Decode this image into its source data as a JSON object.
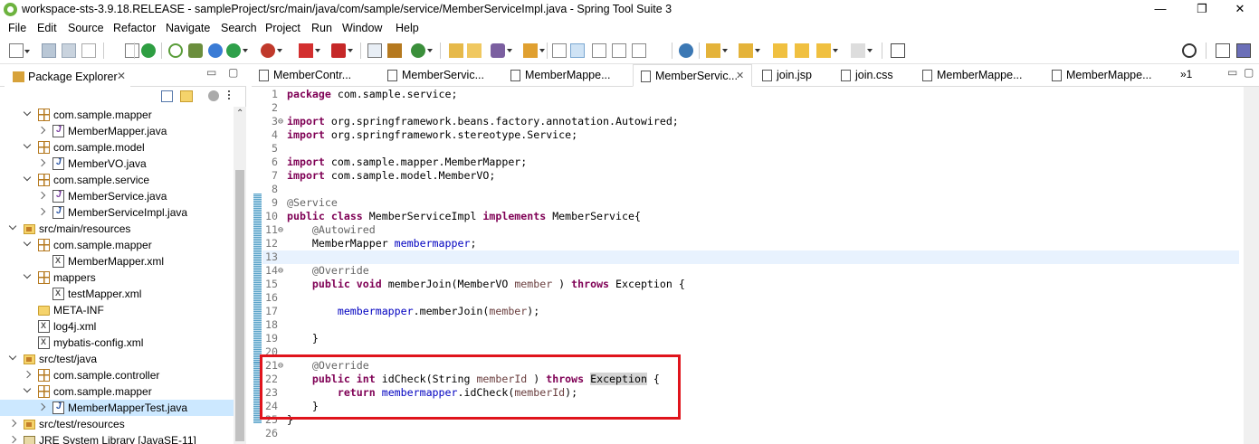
{
  "window": {
    "title": "workspace-sts-3.9.18.RELEASE - sampleProject/src/main/java/com/sample/service/MemberServiceImpl.java - Spring Tool Suite 3",
    "minimize": "—",
    "maximize": "❐",
    "close": "✕"
  },
  "menu": [
    "File",
    "Edit",
    "Source",
    "Refactor",
    "Navigate",
    "Search",
    "Project",
    "Run",
    "Window",
    "Help"
  ],
  "package_explorer": {
    "title": "Package Explorer",
    "close": "✕",
    "minimize": "▭",
    "maximize": "▢",
    "tree": [
      {
        "label": "com.sample.mapper",
        "icon": "package-icon",
        "twisty": "open",
        "level": 3
      },
      {
        "label": "MemberMapper.java",
        "icon": "interface-file-icon",
        "twisty": "closed",
        "level": 4
      },
      {
        "label": "com.sample.model",
        "icon": "package-icon",
        "twisty": "open",
        "level": 3
      },
      {
        "label": "MemberVO.java",
        "icon": "java-file-icon",
        "twisty": "closed",
        "level": 4
      },
      {
        "label": "com.sample.service",
        "icon": "package-icon",
        "twisty": "open",
        "level": 3
      },
      {
        "label": "MemberService.java",
        "icon": "interface-file-icon",
        "twisty": "closed",
        "level": 4
      },
      {
        "label": "MemberServiceImpl.java",
        "icon": "java-file-icon",
        "twisty": "closed",
        "level": 4
      },
      {
        "label": "src/main/resources",
        "icon": "source-folder-icon",
        "twisty": "open",
        "level": 2
      },
      {
        "label": "com.sample.mapper",
        "icon": "package-icon",
        "twisty": "open",
        "level": 3
      },
      {
        "label": "MemberMapper.xml",
        "icon": "xml-file-icon",
        "twisty": "none",
        "level": 4
      },
      {
        "label": "mappers",
        "icon": "package-icon",
        "twisty": "open",
        "level": 3
      },
      {
        "label": "testMapper.xml",
        "icon": "xml-file-icon",
        "twisty": "none",
        "level": 4
      },
      {
        "label": "META-INF",
        "icon": "folder-icon",
        "twisty": "none",
        "level": 3
      },
      {
        "label": "log4j.xml",
        "icon": "xml-file-icon",
        "twisty": "none",
        "level": 3
      },
      {
        "label": "mybatis-config.xml",
        "icon": "xml-file-icon",
        "twisty": "none",
        "level": 3
      },
      {
        "label": "src/test/java",
        "icon": "source-folder-icon",
        "twisty": "open",
        "level": 2
      },
      {
        "label": "com.sample.controller",
        "icon": "package-icon",
        "twisty": "closed",
        "level": 3
      },
      {
        "label": "com.sample.mapper",
        "icon": "package-icon",
        "twisty": "open",
        "level": 3
      },
      {
        "label": "MemberMapperTest.java",
        "icon": "java-file-icon",
        "twisty": "closed",
        "level": 4,
        "selected": true
      },
      {
        "label": "src/test/resources",
        "icon": "source-folder-icon",
        "twisty": "closed",
        "level": 2
      },
      {
        "label": "JRE System Library [JavaSE-11]",
        "icon": "library-icon",
        "twisty": "closed",
        "level": 2
      }
    ]
  },
  "editor_tabs": [
    {
      "label": "MemberContr...",
      "icon": "java-file-icon"
    },
    {
      "label": "MemberServic...",
      "icon": "interface-file-icon"
    },
    {
      "label": "MemberMappe...",
      "icon": "interface-file-icon"
    },
    {
      "label": "MemberServic...",
      "icon": "java-file-icon",
      "active": true,
      "close": "✕"
    },
    {
      "label": "join.jsp",
      "icon": "jsp-file-icon"
    },
    {
      "label": "join.css",
      "icon": "css-file-icon"
    },
    {
      "label": "MemberMappe...",
      "icon": "xml-file-icon"
    },
    {
      "label": "MemberMappe...",
      "icon": "java-file-icon"
    }
  ],
  "overflow_tabs": "»1",
  "code_lines": [
    {
      "n": "1",
      "parts": [
        [
          "k",
          "package"
        ],
        [
          "",
          "com.sample.service;"
        ]
      ]
    },
    {
      "n": "2",
      "parts": []
    },
    {
      "n": "3",
      "fold": "⊖",
      "parts": [
        [
          "k",
          "import"
        ],
        [
          "",
          "org.springframework.beans.factory.annotation.Autowired;"
        ]
      ]
    },
    {
      "n": "4",
      "parts": [
        [
          "k",
          "import"
        ],
        [
          "",
          "org.springframework.stereotype.Service;"
        ]
      ]
    },
    {
      "n": "5",
      "parts": []
    },
    {
      "n": "6",
      "parts": [
        [
          "k",
          "import"
        ],
        [
          "",
          "com.sample.mapper.MemberMapper;"
        ]
      ]
    },
    {
      "n": "7",
      "parts": [
        [
          "k",
          "import"
        ],
        [
          "",
          "com.sample.model.MemberVO;"
        ]
      ]
    },
    {
      "n": "8",
      "parts": []
    },
    {
      "n": "9",
      "parts": [
        [
          "an",
          "@Service"
        ]
      ]
    },
    {
      "n": "10",
      "parts": [
        [
          "k",
          "public"
        ],
        [
          "",
          " "
        ],
        [
          "k",
          "class"
        ],
        [
          "",
          " MemberServiceImpl "
        ],
        [
          "k",
          "implements"
        ],
        [
          "",
          " MemberService{"
        ]
      ]
    },
    {
      "n": "11",
      "fold": "⊖",
      "parts": [
        [
          "",
          "    "
        ],
        [
          "an",
          "@Autowired"
        ]
      ]
    },
    {
      "n": "12",
      "parts": [
        [
          "",
          "    MemberMapper "
        ],
        [
          "fld",
          "membermapper"
        ],
        [
          "",
          ";"
        ]
      ]
    },
    {
      "n": "13",
      "cur": true,
      "parts": []
    },
    {
      "n": "14",
      "fold": "⊖",
      "parts": [
        [
          "",
          "    "
        ],
        [
          "an",
          "@Override"
        ]
      ]
    },
    {
      "n": "15",
      "parts": [
        [
          "",
          "    "
        ],
        [
          "k",
          "public"
        ],
        [
          "",
          " "
        ],
        [
          "k",
          "void"
        ],
        [
          "",
          " memberJoin(MemberVO "
        ],
        [
          "prm",
          "member"
        ],
        [
          "",
          " ) "
        ],
        [
          "k",
          "throws"
        ],
        [
          "",
          " Exception {"
        ]
      ]
    },
    {
      "n": "16",
      "parts": []
    },
    {
      "n": "17",
      "parts": [
        [
          "",
          "        "
        ],
        [
          "fld",
          "membermapper"
        ],
        [
          "",
          ".memberJoin("
        ],
        [
          "prm",
          "member"
        ],
        [
          "",
          ");"
        ]
      ]
    },
    {
      "n": "18",
      "parts": []
    },
    {
      "n": "19",
      "parts": [
        [
          "",
          "    }"
        ]
      ]
    },
    {
      "n": "20",
      "parts": []
    },
    {
      "n": "21",
      "fold": "⊖",
      "parts": [
        [
          "",
          "    "
        ],
        [
          "an",
          "@Override"
        ]
      ]
    },
    {
      "n": "22",
      "parts": [
        [
          "",
          "    "
        ],
        [
          "k",
          "public"
        ],
        [
          "",
          " "
        ],
        [
          "k",
          "int"
        ],
        [
          "",
          " idCheck(String "
        ],
        [
          "prm",
          "memberId"
        ],
        [
          "",
          " ) "
        ],
        [
          "k",
          "throws"
        ],
        [
          "",
          " "
        ],
        [
          "hl",
          "Exception"
        ],
        [
          "",
          " {"
        ]
      ]
    },
    {
      "n": "23",
      "parts": [
        [
          "",
          "        "
        ],
        [
          "k",
          "return"
        ],
        [
          "",
          " "
        ],
        [
          "fld",
          "membermapper"
        ],
        [
          "",
          ".idCheck("
        ],
        [
          "prm",
          "memberId"
        ],
        [
          "",
          ");"
        ]
      ]
    },
    {
      "n": "24",
      "parts": [
        [
          "",
          "    }"
        ]
      ]
    },
    {
      "n": "25",
      "parts": [
        [
          "",
          "}"
        ]
      ]
    },
    {
      "n": "26",
      "parts": []
    }
  ]
}
